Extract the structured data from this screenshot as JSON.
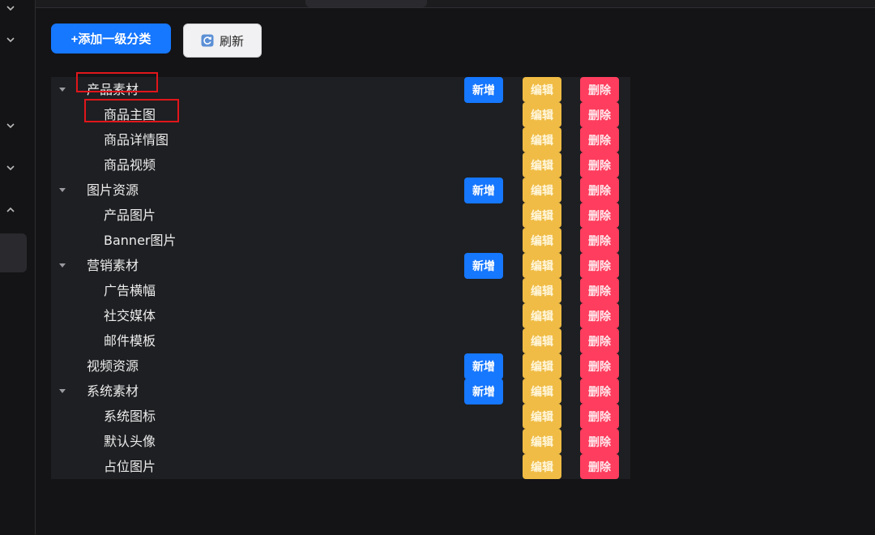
{
  "toolbar": {
    "add_top_label": "+添加一级分类",
    "refresh_label": "刷新"
  },
  "tree": {
    "action_labels": {
      "add": "新增",
      "edit": "编辑",
      "delete": "删除"
    },
    "rows": [
      {
        "label": "产品素材",
        "level": 1,
        "expandable": true,
        "has_add": true,
        "highlighted": true
      },
      {
        "label": "商品主图",
        "level": 2,
        "expandable": false,
        "has_add": false,
        "highlighted": true
      },
      {
        "label": "商品详情图",
        "level": 2,
        "expandable": false,
        "has_add": false,
        "highlighted": false
      },
      {
        "label": "商品视频",
        "level": 2,
        "expandable": false,
        "has_add": false,
        "highlighted": false
      },
      {
        "label": "图片资源",
        "level": 1,
        "expandable": true,
        "has_add": true,
        "highlighted": false
      },
      {
        "label": "产品图片",
        "level": 2,
        "expandable": false,
        "has_add": false,
        "highlighted": false
      },
      {
        "label": "Banner图片",
        "level": 2,
        "expandable": false,
        "has_add": false,
        "highlighted": false
      },
      {
        "label": "营销素材",
        "level": 1,
        "expandable": true,
        "has_add": true,
        "highlighted": false
      },
      {
        "label": "广告横幅",
        "level": 2,
        "expandable": false,
        "has_add": false,
        "highlighted": false
      },
      {
        "label": "社交媒体",
        "level": 2,
        "expandable": false,
        "has_add": false,
        "highlighted": false
      },
      {
        "label": "邮件模板",
        "level": 2,
        "expandable": false,
        "has_add": false,
        "highlighted": false
      },
      {
        "label": "视频资源",
        "level": 1,
        "expandable": false,
        "has_add": true,
        "highlighted": false
      },
      {
        "label": "系统素材",
        "level": 1,
        "expandable": true,
        "has_add": true,
        "highlighted": false
      },
      {
        "label": "系统图标",
        "level": 2,
        "expandable": false,
        "has_add": false,
        "highlighted": false
      },
      {
        "label": "默认头像",
        "level": 2,
        "expandable": false,
        "has_add": false,
        "highlighted": false
      },
      {
        "label": "占位图片",
        "level": 2,
        "expandable": false,
        "has_add": false,
        "highlighted": false
      }
    ]
  },
  "sidebar": {
    "chevrons": [
      "chevron-down-icon",
      "chevron-down-icon",
      "chevron-down-icon",
      "chevron-down-icon",
      "chevron-up-icon"
    ]
  },
  "colors": {
    "background": "#141416",
    "tree_panel": "#1e1f22",
    "primary": "#1677ff",
    "edit": "#f0bc45",
    "delete": "#ff3d5e",
    "highlight_border": "#e0161b"
  }
}
